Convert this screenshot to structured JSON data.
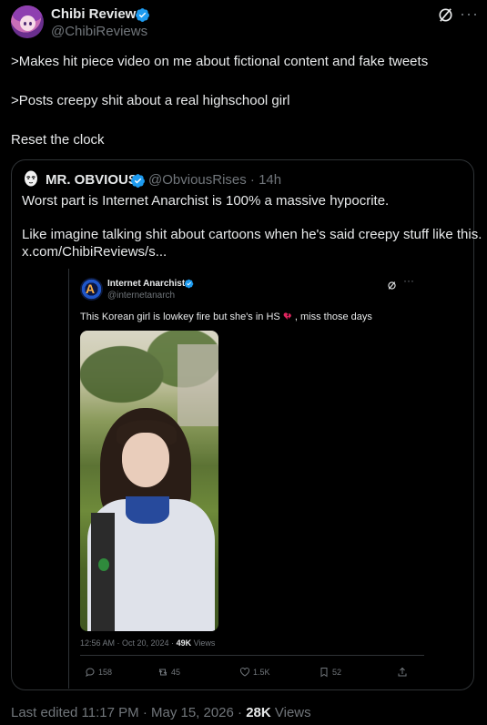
{
  "tweet": {
    "author_name": "Chibi Reviews",
    "author_handle": "@ChibiReviews",
    "lines": [
      ">Makes hit piece video on me about fictional content and fake tweets",
      ">Posts creepy shit about a real highschool girl",
      "Reset the clock"
    ],
    "last_edited": "Last edited 11:17 PM · May 15, 2026 · ",
    "views_count": "28K",
    "views_label": " Views"
  },
  "quote": {
    "author_name": "MR. OBVIOUS",
    "author_handle": "@ObviousRises · 14h",
    "lines": [
      "Worst part is Internet Anarchist is 100% a massive hypocrite.",
      "Like imagine talking shit about cartoons when he's said creepy stuff like this.",
      "x.com/ChibiReviews/s..."
    ]
  },
  "embed": {
    "author_name": "Internet Anarchist",
    "author_handle": "@internetanarch",
    "text": "This Korean girl is lowkey fire but she's in HS",
    "text_after": ", miss those days",
    "time": "12:56 AM · Oct 20, 2024 · ",
    "views_count": "49K",
    "views_label": " Views",
    "replies": "158",
    "reposts": "45",
    "likes": "1.5K",
    "bookmarks": "52"
  },
  "colors": {
    "background": "#000000",
    "text": "#e7e9ea",
    "muted": "#71767b",
    "verified": "#1d9bf0",
    "border": "#2f3336",
    "heart": "#e0245e"
  },
  "icons": [
    "verified-badge-icon",
    "grok-icon",
    "more-icon",
    "reply-icon",
    "repost-icon",
    "like-icon",
    "bookmark-icon",
    "share-icon",
    "broken-heart-emoji"
  ]
}
